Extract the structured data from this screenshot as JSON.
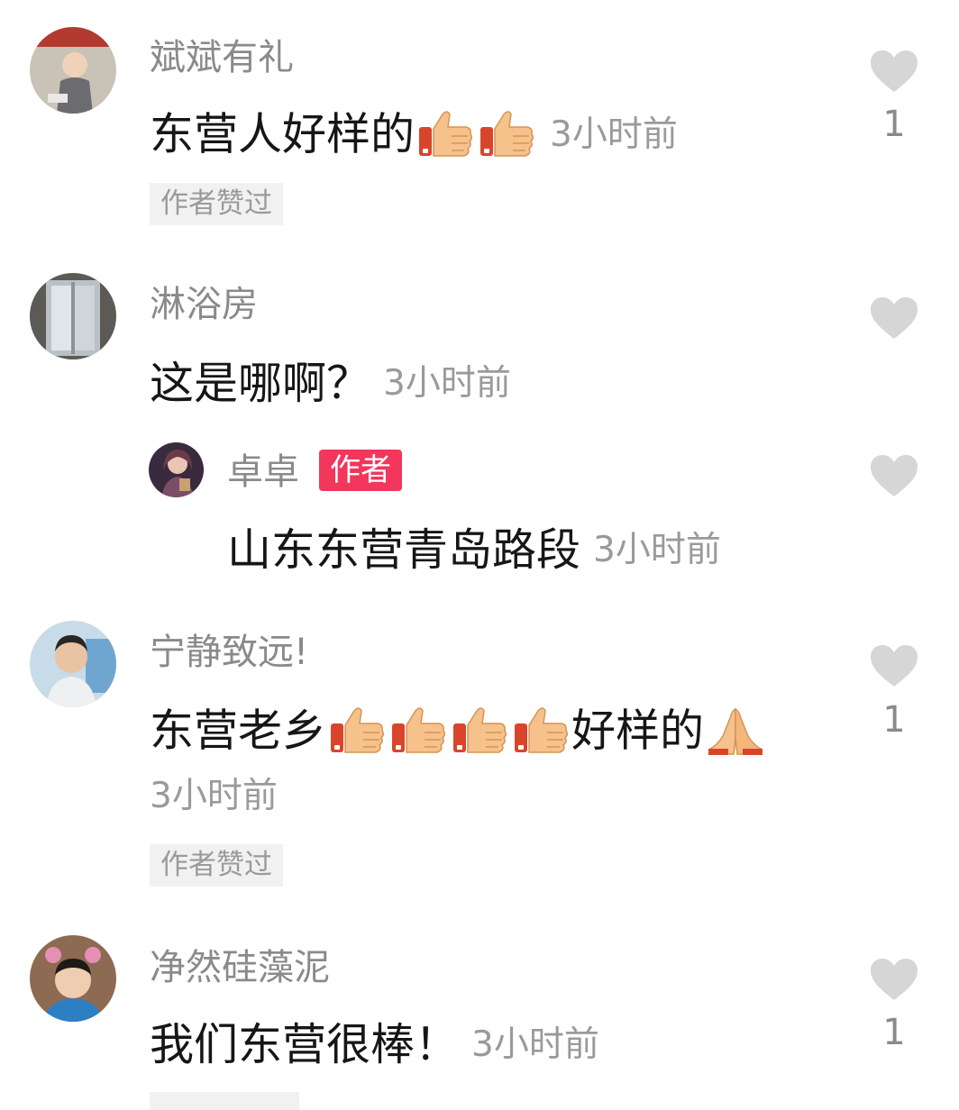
{
  "comments": [
    {
      "username": "斌斌有礼",
      "text": "东营人好样的",
      "emoji_after": [
        "thumbs-up",
        "thumbs-up"
      ],
      "time": "3小时前",
      "author_liked_label": "作者赞过",
      "like_count": "1"
    },
    {
      "username": "淋浴房",
      "text": "这是哪啊？",
      "time": "3小时前",
      "reply": {
        "username": "卓卓",
        "author_tag": "作者",
        "text": "山东东营青岛路段",
        "time": "3小时前"
      }
    },
    {
      "username": "宁静致远!",
      "text_part1": "东营老乡",
      "emoji_middle": [
        "thumbs-up",
        "thumbs-up",
        "thumbs-up",
        "thumbs-up"
      ],
      "text_part2": "好样的",
      "emoji_after": [
        "folded-hands"
      ],
      "time": "3小时前",
      "author_liked_label": "作者赞过",
      "like_count": "1"
    },
    {
      "username": "净然硅藻泥",
      "text": "我们东营很棒！",
      "time": "3小时前",
      "like_count": "1"
    }
  ],
  "colors": {
    "username": "#8a8a8a",
    "comment_text": "#161616",
    "timestamp": "#9a9a9a",
    "author_tag_bg": "#f2365c",
    "heart": "#d6d6d6"
  }
}
